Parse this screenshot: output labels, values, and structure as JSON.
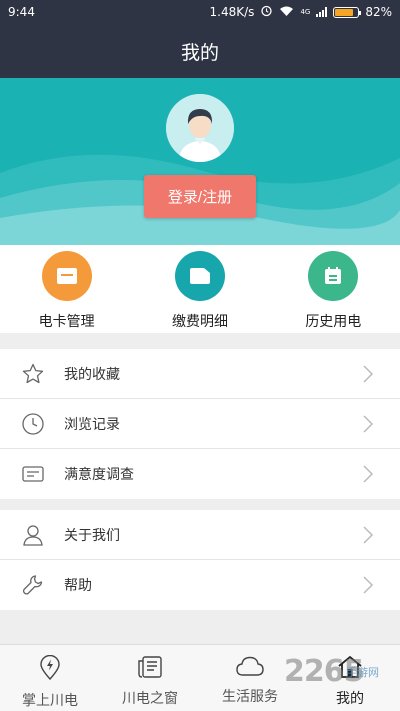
{
  "status_bar": {
    "time": "9:44",
    "speed": "1.48K/s",
    "net_label": "4G",
    "battery": "82%",
    "battery_level": 0.82
  },
  "header": {
    "title": "我的"
  },
  "profile": {
    "login_label": "登录/注册"
  },
  "quick_actions": [
    {
      "label": "电卡管理",
      "icon": "card-icon",
      "color": "#f59a3b"
    },
    {
      "label": "缴费明细",
      "icon": "folder-icon",
      "color": "#17a6ab"
    },
    {
      "label": "历史用电",
      "icon": "calendar-icon",
      "color": "#3cb68b"
    }
  ],
  "menu_group1": [
    {
      "label": "我的收藏",
      "icon": "star-icon"
    },
    {
      "label": "浏览记录",
      "icon": "clock-icon"
    },
    {
      "label": "满意度调查",
      "icon": "survey-card-icon"
    }
  ],
  "menu_group2": [
    {
      "label": "关于我们",
      "icon": "person-icon"
    },
    {
      "label": "帮助",
      "icon": "wrench-icon"
    }
  ],
  "tabs": [
    {
      "label": "掌上川电",
      "icon": "power-pin-icon"
    },
    {
      "label": "川电之窗",
      "icon": "newspaper-icon"
    },
    {
      "label": "生活服务",
      "icon": "cloud-icon"
    },
    {
      "label": "我的",
      "icon": "home-icon",
      "active": true
    }
  ],
  "watermark": {
    "text": "2265",
    "sub": "手游网"
  }
}
